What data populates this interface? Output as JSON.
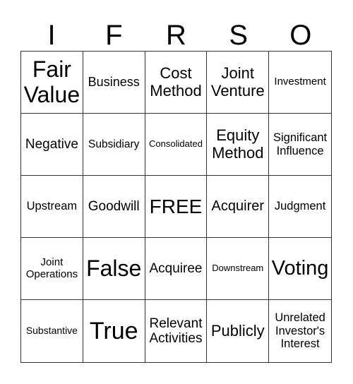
{
  "header": [
    "I",
    "F",
    "R",
    "S",
    "O"
  ],
  "cells": [
    "Fair Value",
    "Business",
    "Cost Method",
    "Joint Venture",
    "Investment",
    "Negative",
    "Subsidiary",
    "Consolidated",
    "Equity Method",
    "Significant Influence",
    "Upstream",
    "Goodwill",
    "FREE",
    "Acquirer",
    "Judgment",
    "Joint Operations",
    "False",
    "Acquiree",
    "Downstream",
    "Voting",
    "Substantive",
    "True",
    "Relevant Activities",
    "Publicly",
    "Unrelated Investor's Interest"
  ]
}
